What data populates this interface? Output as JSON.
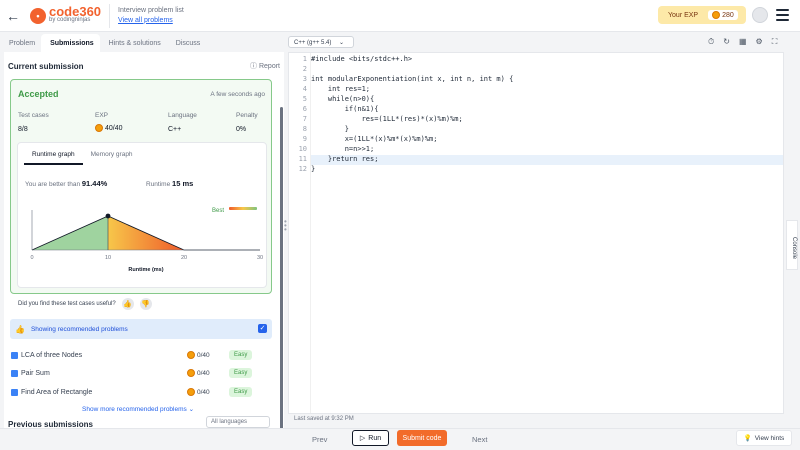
{
  "header": {
    "back_icon": "arrow-left-icon",
    "logo_main": "code360",
    "logo_sub": "by codingninjas",
    "list_title": "Interview problem list",
    "list_link": "View all problems",
    "exp_label": "Your EXP",
    "exp_value": "280"
  },
  "tabs": [
    "Problem",
    "Submissions",
    "Hints & solutions",
    "Discuss"
  ],
  "submission": {
    "title": "Current submission",
    "report": "Report",
    "status": "Accepted",
    "time": "A few seconds ago",
    "labels": {
      "tests": "Test cases",
      "exp": "EXP",
      "language": "Language",
      "penalty": "Penalty"
    },
    "values": {
      "tests": "8/8",
      "exp": "40/40",
      "language": "C++",
      "penalty": "0%"
    },
    "graph_tabs": [
      "Runtime graph",
      "Memory graph"
    ],
    "better_text": "You are better than",
    "better_value": "91.44%",
    "runtime_label": "Runtime",
    "runtime_value": "15 ms",
    "useful_q": "Did you find these test cases useful?"
  },
  "chart_data": {
    "type": "area",
    "x": [
      0,
      10,
      20,
      30
    ],
    "y": [
      0,
      1,
      0,
      0
    ],
    "marker_x": 10,
    "xlim": [
      0,
      30
    ],
    "xticks": [
      "0",
      "10",
      "20",
      "30"
    ],
    "xlabel": "Runtime (ms)",
    "legend": "Best"
  },
  "recommended": {
    "title": "Showing recommended problems",
    "items": [
      {
        "name": "LCA of three Nodes",
        "exp": "0/40",
        "difficulty": "Easy"
      },
      {
        "name": "Pair Sum",
        "exp": "0/40",
        "difficulty": "Easy"
      },
      {
        "name": "Find Area of Rectangle",
        "exp": "0/40",
        "difficulty": "Easy"
      }
    ],
    "more": "Show more recommended problems"
  },
  "previous": {
    "title": "Previous submissions",
    "filter": "All languages"
  },
  "editor": {
    "language": "C++ (g++ 5.4)",
    "lines": [
      "#include <bits/stdc++.h>",
      "",
      "int modularExponentiation(int x, int n, int m) {",
      "    int res=1;",
      "    while(n>0){",
      "        if(n&1){",
      "            res=(1LL*(res)*(x)%m)%m;",
      "        }",
      "        x=(1LL*(x)%m*(x)%m)%m;",
      "        n=n>>1;",
      "    }return res;",
      "}"
    ],
    "highlight_line": 11,
    "saved": "Last saved at 9:32 PM",
    "console": "Console"
  },
  "footer": {
    "prev": "Prev",
    "run": "Run",
    "submit": "Submit code",
    "next": "Next",
    "hints": "View hints"
  },
  "colors": {
    "accent": "#f26b2a",
    "accepted": "#3f9a48",
    "link": "#2563eb"
  }
}
